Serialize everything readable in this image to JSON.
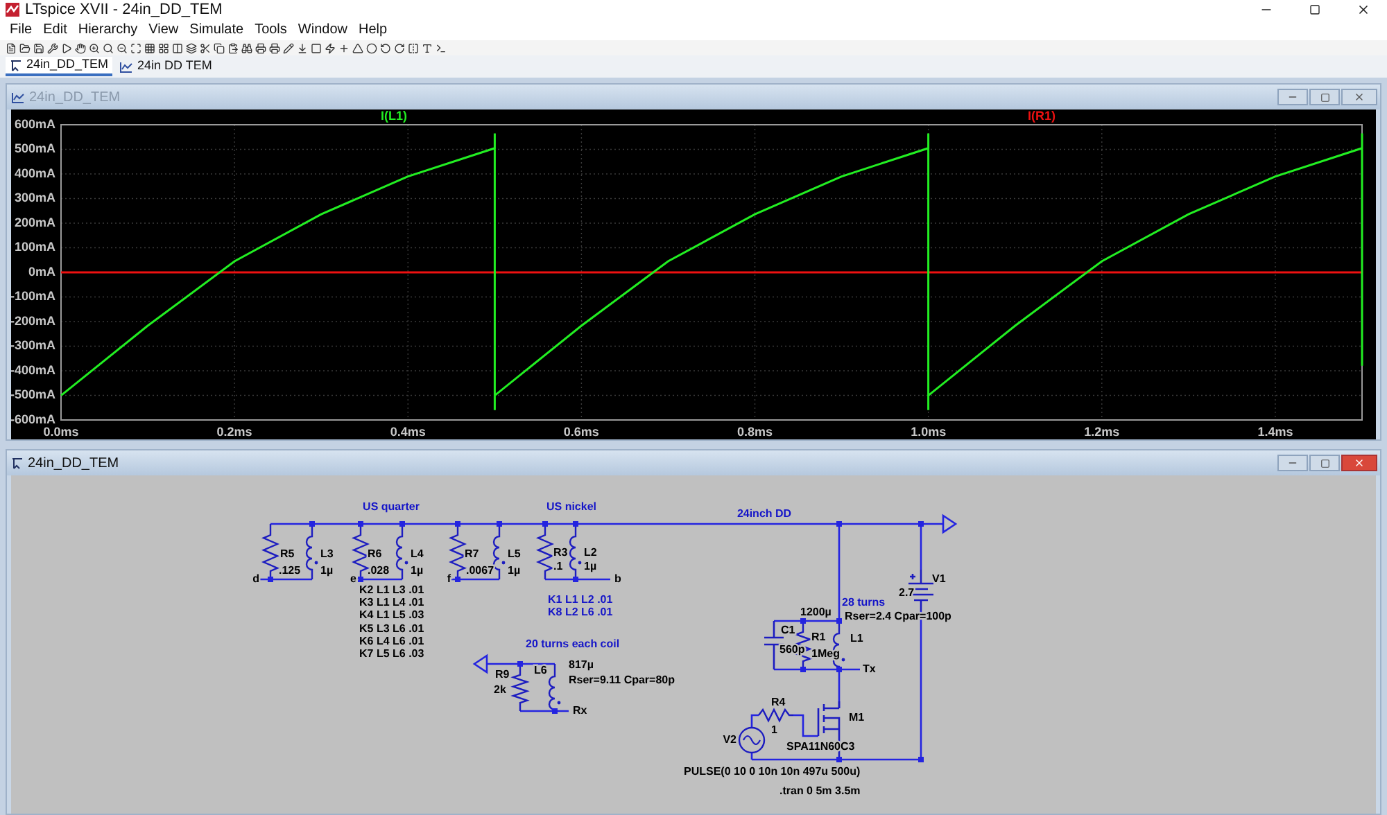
{
  "window": {
    "title": "LTspice XVII - 24in_DD_TEM"
  },
  "menu": [
    "File",
    "Edit",
    "Hierarchy",
    "View",
    "Simulate",
    "Tools",
    "Window",
    "Help"
  ],
  "doc_tabs": [
    {
      "label": "24in_DD_TEM",
      "kind": "schematic",
      "selected": true
    },
    {
      "label": "24in DD TEM",
      "kind": "waveform",
      "selected": false
    }
  ],
  "waveform_window": {
    "title": "24in_DD_TEM",
    "active": false,
    "chart_data": {
      "type": "line",
      "grid": true,
      "x": [
        0,
        0.1,
        0.2,
        0.3,
        0.4,
        0.5,
        0.5,
        0.5,
        0.5,
        0.6,
        0.7,
        0.8,
        0.9,
        1.0,
        1.0,
        1.0,
        1.0,
        1.1,
        1.2,
        1.3,
        1.4,
        1.5,
        1.5,
        1.5
      ],
      "series": [
        {
          "name": "I(L1)",
          "color": "#22ee22",
          "values": [
            -500,
            -217,
            45,
            236,
            390,
            505,
            565,
            -560,
            -500,
            -217,
            45,
            236,
            390,
            505,
            565,
            -560,
            -500,
            -217,
            45,
            236,
            390,
            505,
            565,
            -380
          ]
        },
        {
          "name": "I(R1)",
          "color": "#ee1111",
          "values": [
            0,
            0,
            0,
            0,
            0,
            0,
            0,
            0,
            0,
            0,
            0,
            0,
            0,
            0,
            0,
            0,
            0,
            0,
            0,
            0,
            0,
            0,
            0,
            0
          ]
        }
      ],
      "xlim": [
        0,
        1.5
      ],
      "ylim": [
        -600,
        600
      ],
      "xticks": [
        {
          "value": 0,
          "label": "0.0ms"
        },
        {
          "value": 0.2,
          "label": "0.2ms"
        },
        {
          "value": 0.4,
          "label": "0.4ms"
        },
        {
          "value": 0.6,
          "label": "0.6ms"
        },
        {
          "value": 0.8,
          "label": "0.8ms"
        },
        {
          "value": 1.0,
          "label": "1.0ms"
        },
        {
          "value": 1.2,
          "label": "1.2ms"
        },
        {
          "value": 1.4,
          "label": "1.4ms"
        }
      ],
      "yticks": [
        {
          "value": 600,
          "label": "600mA"
        },
        {
          "value": 500,
          "label": "500mA"
        },
        {
          "value": 400,
          "label": "400mA"
        },
        {
          "value": 300,
          "label": "300mA"
        },
        {
          "value": 200,
          "label": "200mA"
        },
        {
          "value": 100,
          "label": "100mA"
        },
        {
          "value": 0,
          "label": "0mA"
        },
        {
          "value": -100,
          "label": "-100mA"
        },
        {
          "value": -200,
          "label": "-200mA"
        },
        {
          "value": -300,
          "label": "-300mA"
        },
        {
          "value": -400,
          "label": "-400mA"
        },
        {
          "value": -500,
          "label": "-500mA"
        },
        {
          "value": -600,
          "label": "-600mA"
        }
      ]
    }
  },
  "schematic_window": {
    "title": "24in_DD_TEM",
    "active": true,
    "texts": [
      {
        "text": "US quarter",
        "kind": "comment"
      },
      {
        "text": "US nickel",
        "kind": "comment"
      },
      {
        "text": "24inch DD",
        "kind": "comment"
      },
      {
        "text": "R5",
        "kind": "label"
      },
      {
        "text": ".125",
        "kind": "label"
      },
      {
        "text": "L3",
        "kind": "label"
      },
      {
        "text": "1µ",
        "kind": "label"
      },
      {
        "text": "d",
        "kind": "label"
      },
      {
        "text": "R6",
        "kind": "label"
      },
      {
        "text": ".028",
        "kind": "label"
      },
      {
        "text": "L4",
        "kind": "label"
      },
      {
        "text": "1µ",
        "kind": "label"
      },
      {
        "text": "e",
        "kind": "label"
      },
      {
        "text": "R7",
        "kind": "label"
      },
      {
        "text": ".0067",
        "kind": "label"
      },
      {
        "text": "L5",
        "kind": "label"
      },
      {
        "text": "1µ",
        "kind": "label"
      },
      {
        "text": "f",
        "kind": "label"
      },
      {
        "text": "R3",
        "kind": "label"
      },
      {
        "text": ".1",
        "kind": "label"
      },
      {
        "text": "L2",
        "kind": "label"
      },
      {
        "text": "1µ",
        "kind": "label"
      },
      {
        "text": "b",
        "kind": "label"
      },
      {
        "text": "K2 L1 L3 .01",
        "kind": "label"
      },
      {
        "text": "K3 L1 L4 .01",
        "kind": "label"
      },
      {
        "text": "K4 L1 L5 .03",
        "kind": "label"
      },
      {
        "text": "K5 L3 L6 .01",
        "kind": "label"
      },
      {
        "text": "K6 L4 L6 .01",
        "kind": "label"
      },
      {
        "text": "K7 L5 L6 .03",
        "kind": "label"
      },
      {
        "text": "K1 L1 L2 .01",
        "kind": "comment"
      },
      {
        "text": "K8 L2 L6 .01",
        "kind": "comment"
      },
      {
        "text": "20 turns each coil",
        "kind": "comment"
      },
      {
        "text": "R9",
        "kind": "label"
      },
      {
        "text": "2k",
        "kind": "label"
      },
      {
        "text": "L6",
        "kind": "label"
      },
      {
        "text": "817µ",
        "kind": "label"
      },
      {
        "text": "Rser=9.11 Cpar=80p",
        "kind": "label"
      },
      {
        "text": "Rx",
        "kind": "label"
      },
      {
        "text": "28 turns",
        "kind": "comment"
      },
      {
        "text": "1200µ",
        "kind": "label"
      },
      {
        "text": "Rser=2.4 Cpar=100p",
        "kind": "label"
      },
      {
        "text": "C1",
        "kind": "label"
      },
      {
        "text": "560p",
        "kind": "label"
      },
      {
        "text": "R1",
        "kind": "label"
      },
      {
        "text": "1Meg",
        "kind": "label"
      },
      {
        "text": "L1",
        "kind": "label"
      },
      {
        "text": "Tx",
        "kind": "label"
      },
      {
        "text": "M1",
        "kind": "label"
      },
      {
        "text": "R4",
        "kind": "label"
      },
      {
        "text": "V2",
        "kind": "label"
      },
      {
        "text": "1",
        "kind": "label"
      },
      {
        "text": "SPA11N60C3",
        "kind": "label"
      },
      {
        "text": "V1",
        "kind": "label"
      },
      {
        "text": "2.7",
        "kind": "label"
      },
      {
        "text": "PULSE(0 10 0 10n 10n 497u 500u)",
        "kind": "label"
      },
      {
        "text": ".tran 0 5m 3.5m",
        "kind": "label"
      }
    ]
  }
}
